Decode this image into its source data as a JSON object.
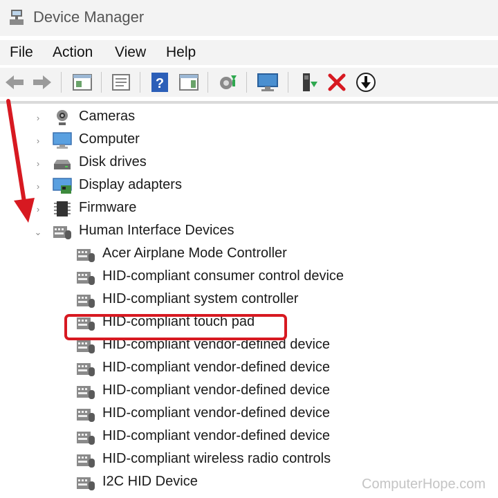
{
  "window": {
    "title": "Device Manager"
  },
  "menu": [
    "File",
    "Action",
    "View",
    "Help"
  ],
  "toolbar": {
    "icons": [
      "back-arrow-icon",
      "forward-arrow-icon",
      "properties-pane-icon",
      "properties-sheet-icon",
      "help-icon",
      "action-pane-icon",
      "update-driver-icon",
      "scan-hardware-icon",
      "enable-device-icon",
      "uninstall-device-icon",
      "disable-device-icon"
    ]
  },
  "tree": {
    "categories": [
      {
        "label": "Cameras",
        "icon": "camera-icon",
        "expanded": false
      },
      {
        "label": "Computer",
        "icon": "computer-icon",
        "expanded": false
      },
      {
        "label": "Disk drives",
        "icon": "disk-drive-icon",
        "expanded": false
      },
      {
        "label": "Display adapters",
        "icon": "display-adapter-icon",
        "expanded": false
      },
      {
        "label": "Firmware",
        "icon": "firmware-icon",
        "expanded": false
      },
      {
        "label": "Human Interface Devices",
        "icon": "hid-icon",
        "expanded": true
      }
    ],
    "hid_children": [
      "Acer Airplane Mode Controller",
      "HID-compliant consumer control device",
      "HID-compliant system controller",
      "HID-compliant touch pad",
      "HID-compliant vendor-defined device",
      "HID-compliant vendor-defined device",
      "HID-compliant vendor-defined device",
      "HID-compliant vendor-defined device",
      "HID-compliant vendor-defined device",
      "HID-compliant wireless radio controls",
      "I2C HID Device"
    ],
    "highlighted_child": "HID-compliant touch pad"
  },
  "colors": {
    "highlight": "#d71921",
    "arrow": "#d71921"
  },
  "watermark": "ComputerHope.com"
}
